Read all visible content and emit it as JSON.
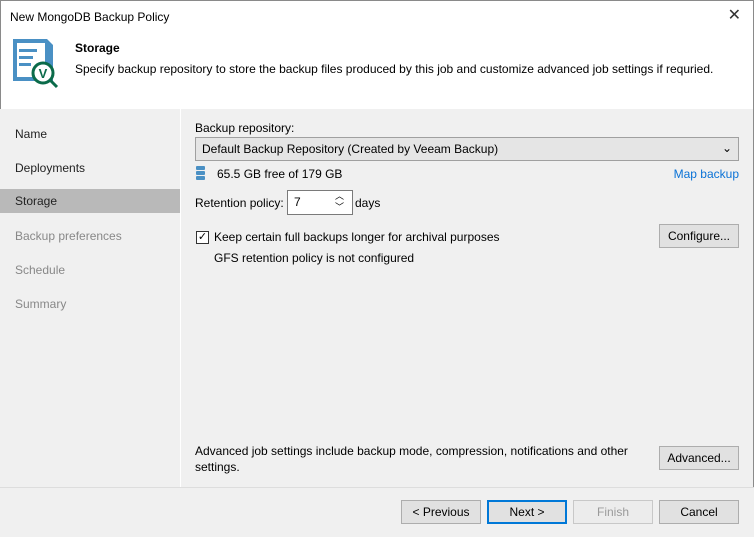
{
  "window": {
    "title": "New MongoDB Backup Policy"
  },
  "header": {
    "title": "Storage",
    "description": "Specify backup repository to store the backup files produced by this job and customize advanced job settings if requried."
  },
  "sidebar": {
    "items": [
      {
        "label": "Name"
      },
      {
        "label": "Deployments"
      },
      {
        "label": "Storage"
      },
      {
        "label": "Backup preferences"
      },
      {
        "label": "Schedule"
      },
      {
        "label": "Summary"
      }
    ]
  },
  "main": {
    "repo_label": "Backup repository:",
    "repo_value": "Default Backup Repository (Created by Veeam Backup)",
    "free_space": "65.5 GB free of 179 GB",
    "map_backup": "Map backup",
    "retention_label": "Retention policy:",
    "retention_value": "7",
    "retention_unit": "days",
    "gfs_checkbox": "Keep certain full backups longer for archival purposes",
    "gfs_checked": true,
    "configure": "Configure...",
    "gfs_status": "GFS retention policy is not configured",
    "advanced_text": "Advanced job settings include backup mode, compression, notifications and other settings.",
    "advanced": "Advanced..."
  },
  "footer": {
    "previous": "< Previous",
    "next": "Next >",
    "finish": "Finish",
    "cancel": "Cancel"
  }
}
